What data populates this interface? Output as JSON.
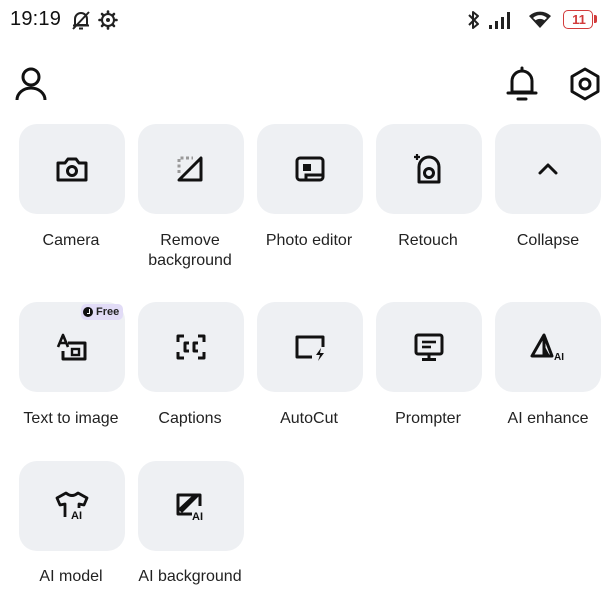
{
  "status_bar": {
    "time": "19:19",
    "battery": "11",
    "icons": [
      "bell-off-icon",
      "settings-gear-icon",
      "bluetooth-icon",
      "signal-icon",
      "wifi-icon",
      "battery-icon"
    ]
  },
  "header": {
    "icons": [
      "profile-icon",
      "notification-bell-icon",
      "settings-hexagon-icon"
    ]
  },
  "tools": [
    {
      "label": "Camera",
      "icon": "camera-icon"
    },
    {
      "label": "Remove background",
      "icon": "remove-background-icon"
    },
    {
      "label": "Photo editor",
      "icon": "photo-editor-icon"
    },
    {
      "label": "Retouch",
      "icon": "retouch-icon"
    },
    {
      "label": "Collapse",
      "icon": "chevron-up-icon"
    },
    {
      "label": "Text to image",
      "icon": "text-to-image-icon",
      "badge": "Free"
    },
    {
      "label": "Captions",
      "icon": "captions-icon"
    },
    {
      "label": "AutoCut",
      "icon": "autocut-icon"
    },
    {
      "label": "Prompter",
      "icon": "prompter-icon"
    },
    {
      "label": "AI enhance",
      "icon": "ai-enhance-icon"
    },
    {
      "label": "AI model",
      "icon": "ai-model-icon"
    },
    {
      "label": "AI background",
      "icon": "ai-background-icon"
    }
  ],
  "colors": {
    "tile_background": "#eef0f3",
    "badge_background": "#e2dcf7",
    "icon": "#111111"
  }
}
